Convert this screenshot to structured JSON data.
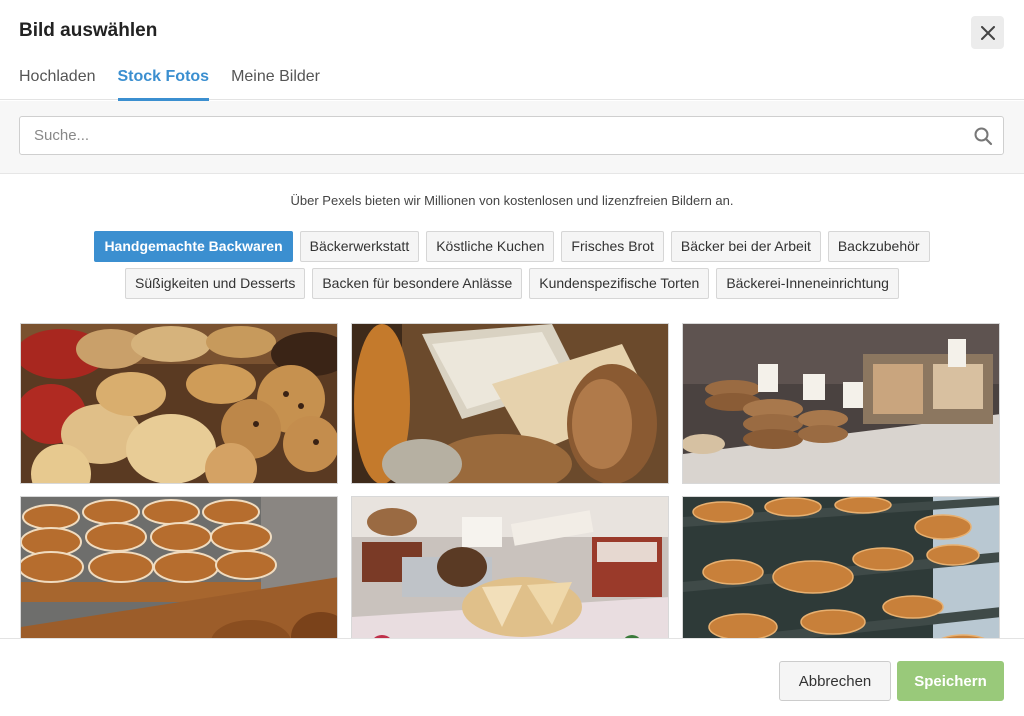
{
  "dialog": {
    "title": "Bild auswählen",
    "close_icon": "close-icon"
  },
  "tabs": [
    {
      "label": "Hochladen",
      "active": false
    },
    {
      "label": "Stock Fotos",
      "active": true
    },
    {
      "label": "Meine Bilder",
      "active": false
    }
  ],
  "search": {
    "placeholder": "Suche...",
    "value": "",
    "icon": "search-icon"
  },
  "info_text": "Über Pexels bieten wir Millionen von kostenlosen und lizenzfreien Bildern an.",
  "categories": {
    "row1": [
      "Handgemachte Backwaren",
      "Bäckerwerkstatt",
      "Köstliche Kuchen",
      "Frisches Brot",
      "Bäcker bei der Arbeit",
      "Backzubehör"
    ],
    "row2": [
      "Süßigkeiten und Desserts",
      "Backen für besondere Anlässe",
      "Kundenspezifische Torten",
      "Bäckerei-Inneneinrichtung"
    ],
    "active": "Handgemachte Backwaren"
  },
  "photos": [
    {
      "name": "scones-and-cookies-photo"
    },
    {
      "name": "sliced-bread-photo"
    },
    {
      "name": "cookies-in-display-case-photo"
    },
    {
      "name": "cinnamon-rolls-tray-photo"
    },
    {
      "name": "bakery-table-display-photo"
    },
    {
      "name": "pastry-shelves-photo"
    }
  ],
  "footer": {
    "cancel_label": "Abbrechen",
    "save_label": "Speichern"
  },
  "colors": {
    "accent": "#3b8fd0",
    "save": "#99c97a"
  }
}
